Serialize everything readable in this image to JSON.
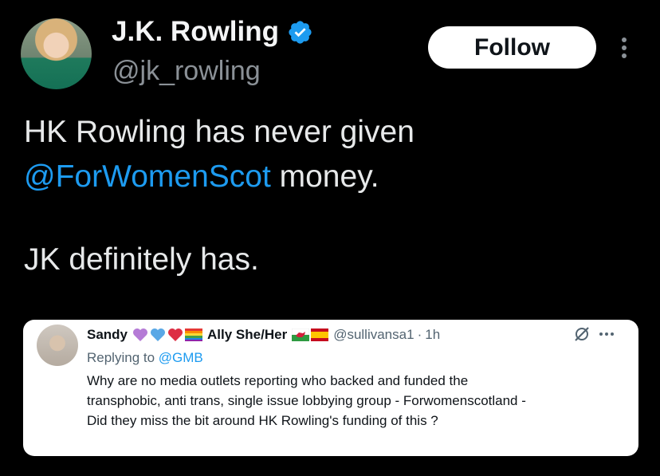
{
  "tweet": {
    "author": {
      "name": "J.K. Rowling",
      "handle": "@jk_rowling",
      "verified": true
    },
    "follow_label": "Follow",
    "text": {
      "line1": "HK Rowling has never given",
      "mention": "@ForWomenScot",
      "line2_rest": " money.",
      "line3": "JK definitely has."
    }
  },
  "quote": {
    "name": "Sandy",
    "pronouns": "Ally She/Her",
    "handle": "@sullivansa1",
    "separator": "·",
    "time": "1h",
    "replying_prefix": "Replying to ",
    "replying_to": "@GMB",
    "body_lines": [
      "Why are no media outlets reporting who backed and funded the",
      "transphobic, anti trans, single issue lobbying group - Forwomenscotland -",
      "Did they miss the bit around HK Rowling's funding of this ?"
    ]
  },
  "colors": {
    "background": "#000000",
    "link": "#1d9bf0",
    "verified": "#1d9bf0",
    "secondary_text": "#8b9197"
  },
  "icons": [
    "verified-badge-icon",
    "more-vertical-icon",
    "grok-icon",
    "more-horizontal-icon",
    "purple-heart-emoji",
    "blue-heart-emoji",
    "red-heart-emoji",
    "rainbow-flag-emoji",
    "wales-flag-emoji",
    "spain-flag-emoji"
  ]
}
